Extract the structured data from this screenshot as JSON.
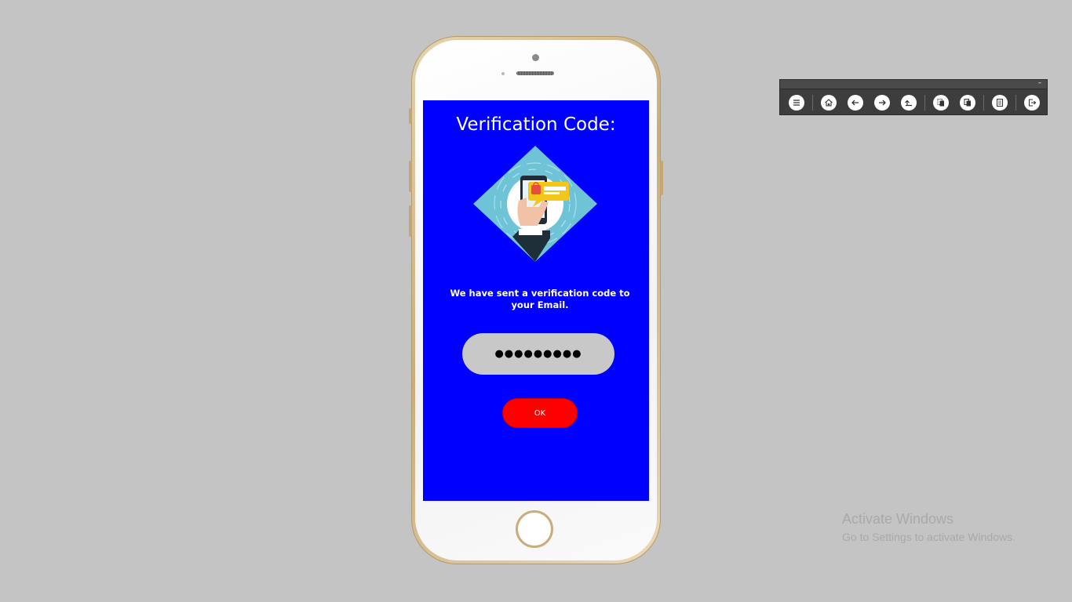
{
  "screen": {
    "title": "Verification Code:",
    "message": "We have sent a verification code to your Email.",
    "code_value": "●●●●●●●●●",
    "ok_label": "OK",
    "colors": {
      "screen_bg": "#0000ff",
      "input_bg": "#c8c8c8",
      "button_bg": "#ff0000"
    }
  },
  "toolbar": {
    "minimize_label": "–",
    "buttons": [
      {
        "name": "menu-icon"
      },
      {
        "name": "home-icon"
      },
      {
        "name": "arrow-left-icon"
      },
      {
        "name": "arrow-right-icon"
      },
      {
        "name": "return-icon"
      },
      {
        "name": "copy-icon"
      },
      {
        "name": "paste-icon"
      },
      {
        "name": "document-icon"
      },
      {
        "name": "exit-icon"
      }
    ]
  },
  "watermark": {
    "title": "Activate Windows",
    "subtitle": "Go to Settings to activate Windows."
  }
}
